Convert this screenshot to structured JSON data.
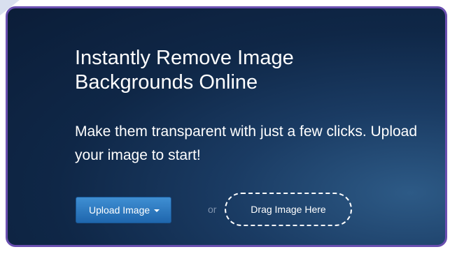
{
  "hero": {
    "title": "Instantly Remove Image Backgrounds Online",
    "subtitle": "Make them transparent with just a few clicks. Upload your image to start!"
  },
  "actions": {
    "upload_label": "Upload Image",
    "upload_icon": "caret-down-icon",
    "or_label": "or",
    "drag_label": "Drag Image Here"
  },
  "colors": {
    "panel_border": "#6a4fb0",
    "panel_background": "#0f2747",
    "button_accent": "#2a78c2"
  }
}
